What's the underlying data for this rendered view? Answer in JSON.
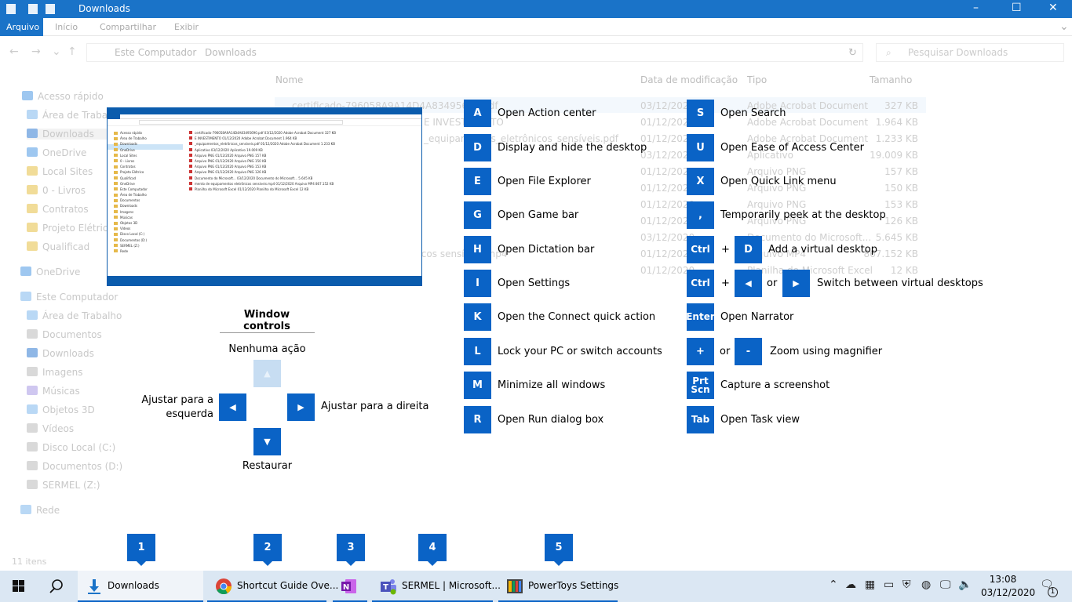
{
  "explorer": {
    "title": "Downloads",
    "ribbon_tabs": [
      "Arquivo",
      "Início",
      "Compartilhar",
      "Exibir"
    ],
    "breadcrumb": [
      "Este Computador",
      "Downloads"
    ],
    "search_placeholder": "Pesquisar Downloads",
    "columns": [
      "Nome",
      "Data de modificação",
      "Tipo",
      "Tamanho"
    ],
    "nav_items": [
      "Acesso rápido",
      "Área de Trabalho",
      "Downloads",
      "OneDrive",
      "Local Sites",
      "0 - Livros",
      "Contratos",
      "Projeto Elétrico",
      "Qualificad",
      "OneDrive",
      "Este Computador",
      "Área de Trabalho",
      "Documentos",
      "Downloads",
      "Imagens",
      "Músicas",
      "Objetos 3D",
      "Vídeos",
      "Disco Local (C:)",
      "Documentos (D:)",
      "SERMEL (Z:)",
      "Rede"
    ],
    "files": [
      {
        "name": "certificado-796058A9A14D4A83495690.pdf",
        "date": "03/12/2020",
        "type": "Adobe Acrobat Document",
        "size": "327 KB"
      },
      {
        "name": "E INVESTIMENTO",
        "date": "01/12/2020",
        "type": "Adobe Acrobat Document",
        "size": "1.964 KB"
      },
      {
        "name": "_equipamentos_eletrônicos_sensíveis.pdf",
        "date": "01/12/2020",
        "type": "Adobe Acrobat Document",
        "size": "1.233 KB"
      },
      {
        "name": "",
        "date": "03/12/2020",
        "type": "Aplicativo",
        "size": "19.009 KB"
      },
      {
        "name": "",
        "date": "01/12/2020",
        "type": "Arquivo PNG",
        "size": "157 KB"
      },
      {
        "name": "",
        "date": "01/12/2020",
        "type": "Arquivo PNG",
        "size": "150 KB"
      },
      {
        "name": "",
        "date": "01/12/2020",
        "type": "Arquivo PNG",
        "size": "153 KB"
      },
      {
        "name": "",
        "date": "01/12/2020",
        "type": "Arquivo PNG",
        "size": "126 KB"
      },
      {
        "name": "",
        "date": "03/12/2020",
        "type": "Documento do Microsoft...",
        "size": "5.645 KB"
      },
      {
        "name": "mento de equipamentos eletrônicos sensíveis.mp4",
        "date": "01/12/2020",
        "type": "Arquivo MP4",
        "size": "867.152 KB"
      },
      {
        "name": "",
        "date": "01/12/2020",
        "type": "Planilha do Microsoft Excel",
        "size": "12 KB"
      }
    ],
    "status": "11 itens"
  },
  "window_controls": {
    "title": "Window controls",
    "up": "Nenhuma ação",
    "left": "Ajustar para a esquerda",
    "right": "Ajustar para a direita",
    "down": "Restaurar"
  },
  "shortcuts_left": [
    {
      "key": "A",
      "label": "Open Action center"
    },
    {
      "key": "D",
      "label": "Display and hide the desktop"
    },
    {
      "key": "E",
      "label": "Open File Explorer"
    },
    {
      "key": "G",
      "label": "Open Game bar"
    },
    {
      "key": "H",
      "label": "Open Dictation bar"
    },
    {
      "key": "I",
      "label": "Open Settings"
    },
    {
      "key": "K",
      "label": "Open the Connect quick action"
    },
    {
      "key": "L",
      "label": "Lock your PC or switch accounts"
    },
    {
      "key": "M",
      "label": "Minimize all windows"
    },
    {
      "key": "R",
      "label": "Open Run dialog box"
    }
  ],
  "shortcuts_right": {
    "s": {
      "key": "S",
      "label": "Open Search"
    },
    "u": {
      "key": "U",
      "label": "Open Ease of Access Center"
    },
    "x": {
      "key": "X",
      "label": "Open Quick Link menu"
    },
    "comma": {
      "key": ",",
      "label": "Temporarily peek at the desktop"
    },
    "ctrl_d": {
      "key1": "Ctrl",
      "plus": "+",
      "key2": "D",
      "label": "Add a virtual desktop"
    },
    "ctrl_arrows": {
      "key1": "Ctrl",
      "plus": "+",
      "or": "or",
      "label": "Switch between virtual desktops"
    },
    "enter": {
      "key": "Enter",
      "label": "Open Narrator"
    },
    "zoom": {
      "key1": "+",
      "or": "or",
      "key2": "-",
      "label": "Zoom using magnifier"
    },
    "prtscn": {
      "key": "Prt Scn",
      "label": "Capture a screenshot"
    },
    "tab": {
      "key": "Tab",
      "label": "Open Task view"
    }
  },
  "taskbar": {
    "apps": [
      {
        "number": "1",
        "label": "Downloads"
      },
      {
        "number": "2",
        "label": "Shortcut Guide Ove..."
      },
      {
        "number": "3",
        "label": ""
      },
      {
        "number": "4",
        "label": "SERMEL | Microsoft..."
      },
      {
        "number": "5",
        "label": "PowerToys Settings"
      }
    ],
    "time": "13:08",
    "date": "03/12/2020",
    "notification_count": "1"
  },
  "colors": {
    "accent": "#0a63c6",
    "disabled": "#c7ddf2",
    "taskbar": "#dbe7f3"
  }
}
